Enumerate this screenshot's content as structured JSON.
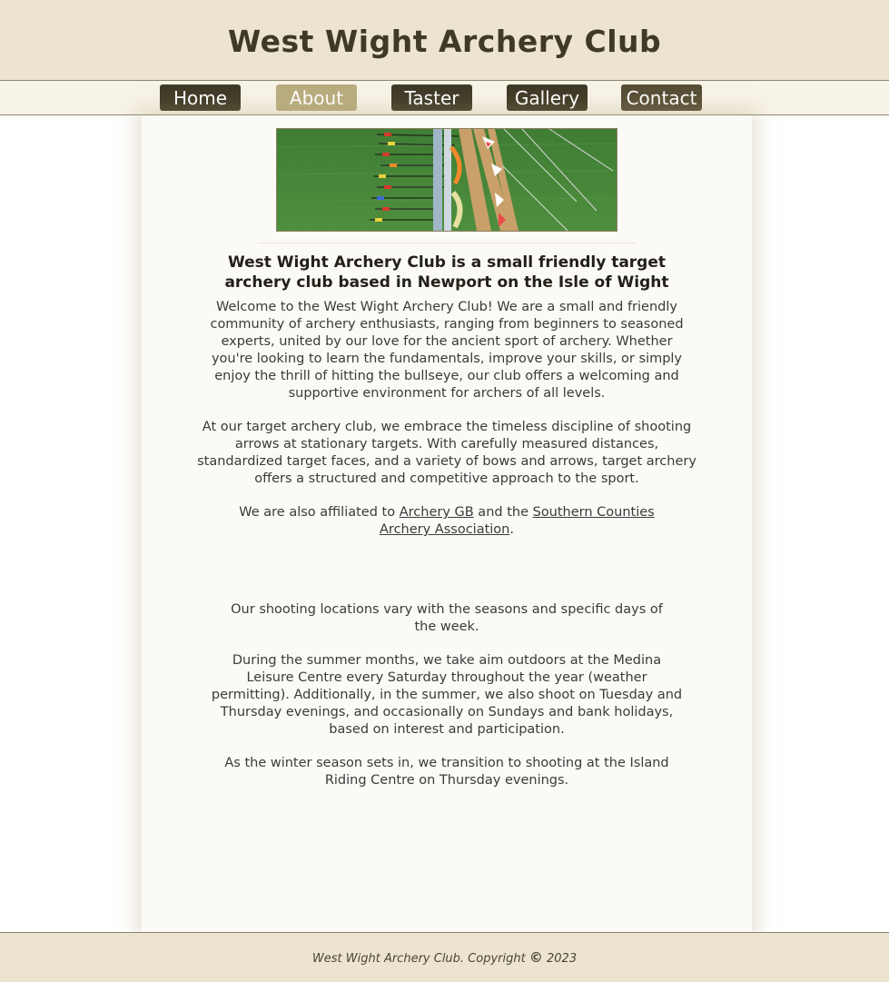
{
  "header": {
    "title": "West Wight Archery Club"
  },
  "nav": {
    "items": [
      {
        "label": "Home"
      },
      {
        "label": "About"
      },
      {
        "label": "Taster"
      },
      {
        "label": "Gallery"
      },
      {
        "label": "Contact"
      }
    ],
    "active": "About"
  },
  "main": {
    "heading": "West Wight Archery Club is a small friendly target archery club based in Newport on the Isle of Wight",
    "p1": "Welcome to the West Wight Archery Club! We are a small and friendly community of archery enthusiasts, ranging from beginners to seasoned experts, united by our love for the ancient sport of archery. Whether you're looking to learn the fundamentals, improve your skills, or simply enjoy the thrill of hitting the bullseye, our club offers a welcoming and supportive environment for archers of all levels.",
    "p2": "At our target archery club, we embrace the timeless discipline of shooting arrows at stationary targets. With carefully measured distances, standardized target faces, and a variety of bows and arrows, target archery offers a structured and competitive approach to the sport.",
    "affiliation": {
      "prefix": "We are also affiliated to ",
      "link1": "Archery GB",
      "middle": " and the ",
      "link2": "Southern Counties Archery Association",
      "suffix": "."
    },
    "p4": "Our shooting locations vary with the seasons and specific days of the week.",
    "p5": "During the summer months, we take aim outdoors at the Medina Leisure Centre every Saturday throughout the year (weather permitting).  Additionally, in the summer, we also shoot on Tuesday and Thursday evenings, and occasionally on Sundays and bank holidays, based on interest and participation.",
    "p6": "As the winter season sets in, we transition to shooting at the Island Riding Centre on Thursday evenings."
  },
  "footer": {
    "text": "West Wight Archery Club.   Copyright",
    "copyright_symbol": "©",
    "year": "2023"
  }
}
